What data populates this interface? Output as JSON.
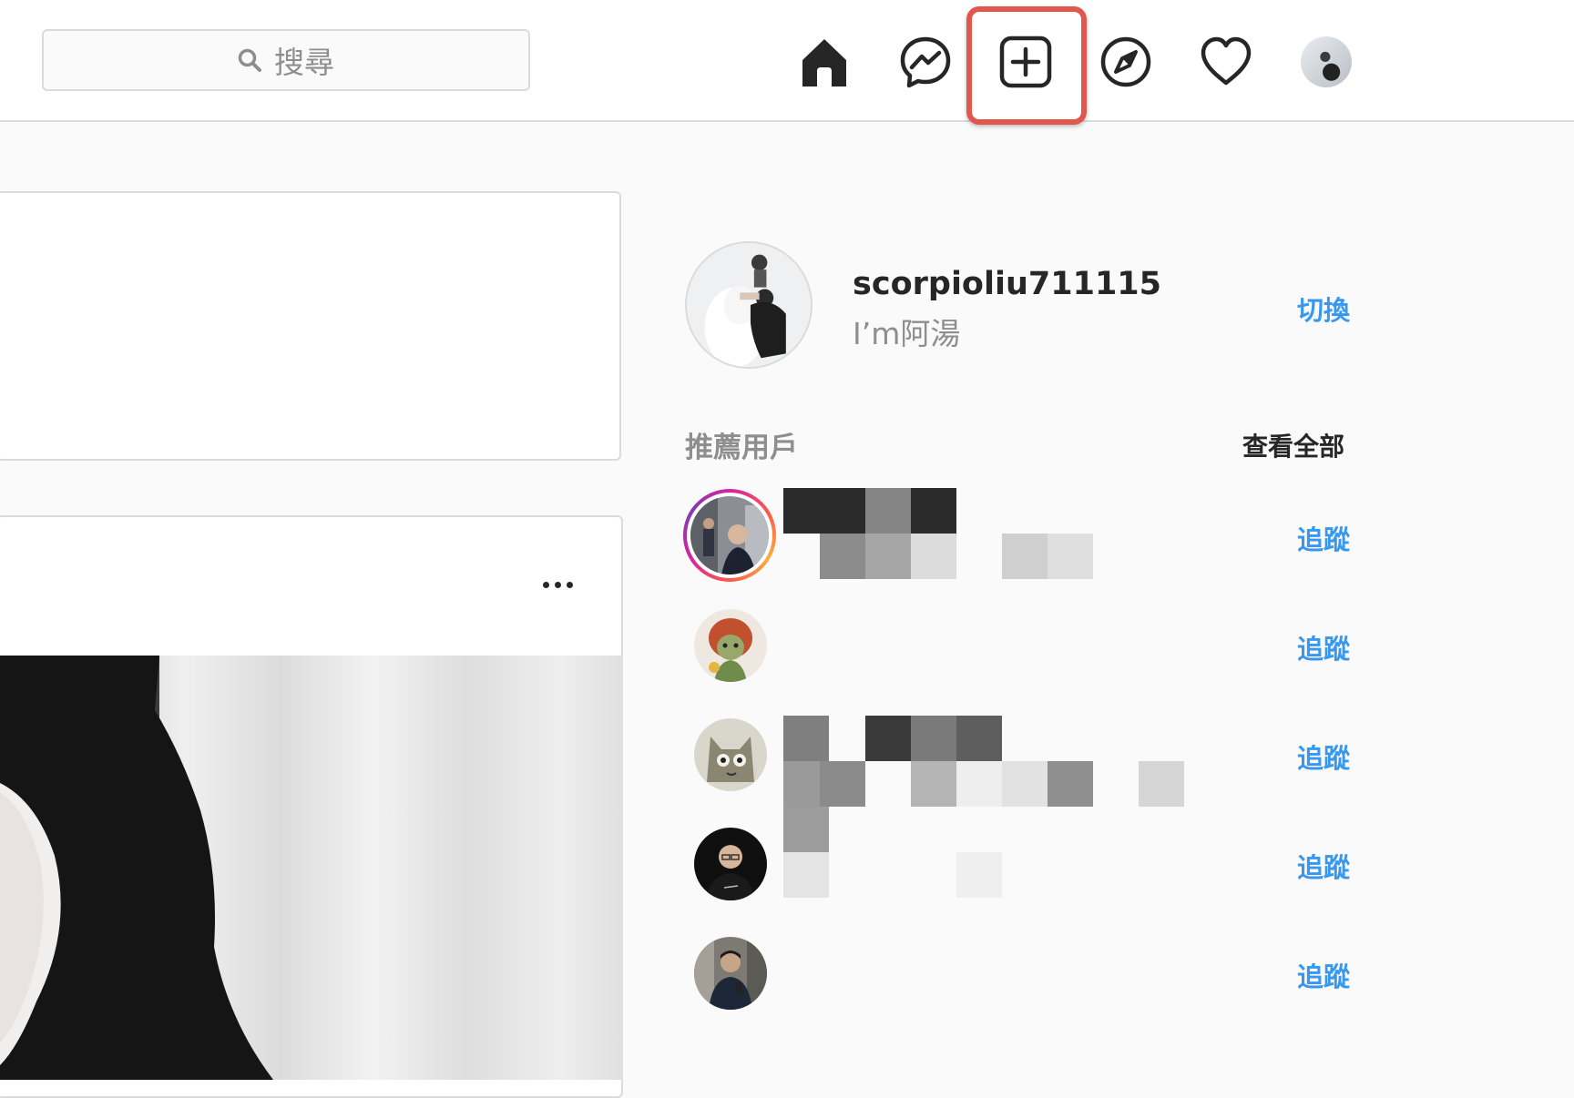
{
  "topbar": {
    "search_placeholder": "搜尋",
    "nav_icons": [
      "home-icon",
      "messenger-icon",
      "new-post-icon",
      "explore-compass-icon",
      "activity-heart-icon",
      "profile-avatar"
    ],
    "highlighted_icon": "new-post-icon",
    "highlight_color": "#e2574c"
  },
  "profile": {
    "username": "scorpioliu711115",
    "full_name": "I’m阿湯",
    "switch_label": "切換"
  },
  "suggestions": {
    "title": "推薦用戶",
    "see_all_label": "查看全部",
    "items": [
      {
        "follow_label": "追蹤",
        "has_story": true,
        "name_obscured": true
      },
      {
        "follow_label": "追蹤",
        "has_story": false,
        "name_obscured": false
      },
      {
        "follow_label": "追蹤",
        "has_story": false,
        "name_obscured": true
      },
      {
        "follow_label": "追蹤",
        "has_story": false,
        "name_obscured": true
      },
      {
        "follow_label": "追蹤",
        "has_story": false,
        "name_obscured": false
      }
    ]
  },
  "feed": {
    "post_menu_icon": "more-options-icon"
  },
  "colors": {
    "link_blue": "#3897f0",
    "border": "#dbdbdb",
    "background": "#fafafa",
    "text_primary": "#262626",
    "text_secondary": "#8e8e8e"
  }
}
